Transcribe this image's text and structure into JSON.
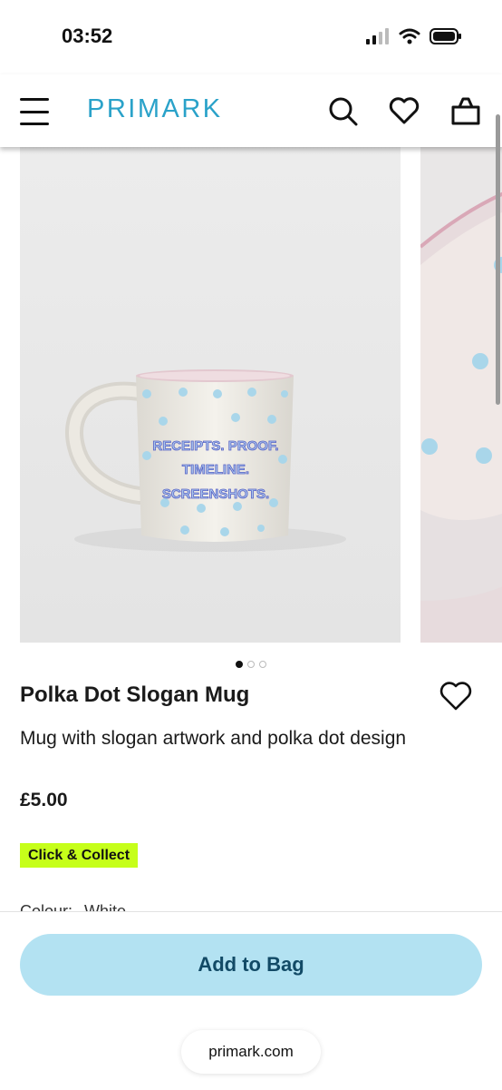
{
  "status_bar": {
    "time": "03:52"
  },
  "header": {
    "brand": "PRIMARK",
    "icons": [
      "menu-icon",
      "search-icon",
      "heart-icon",
      "bag-icon"
    ],
    "brand_color": "#2aa2c9"
  },
  "gallery": {
    "mug_text_lines": [
      "RECEIPTS. PROOF.",
      "TIMELINE.",
      "SCREENSHOTS."
    ],
    "slide_count": 3,
    "active_slide": 1
  },
  "product": {
    "title": "Polka Dot Slogan Mug",
    "description": "Mug with slogan artwork and polka dot design",
    "price": "£5.00",
    "badge": "Click & Collect",
    "colour_label": "Colour:",
    "colour_value": "White"
  },
  "actions": {
    "add_to_bag": "Add to Bag"
  },
  "browser": {
    "url": "primark.com"
  },
  "colors": {
    "badge": "#c6ff1a",
    "add_button": "#b3e2f2",
    "add_button_text": "#124a66"
  }
}
